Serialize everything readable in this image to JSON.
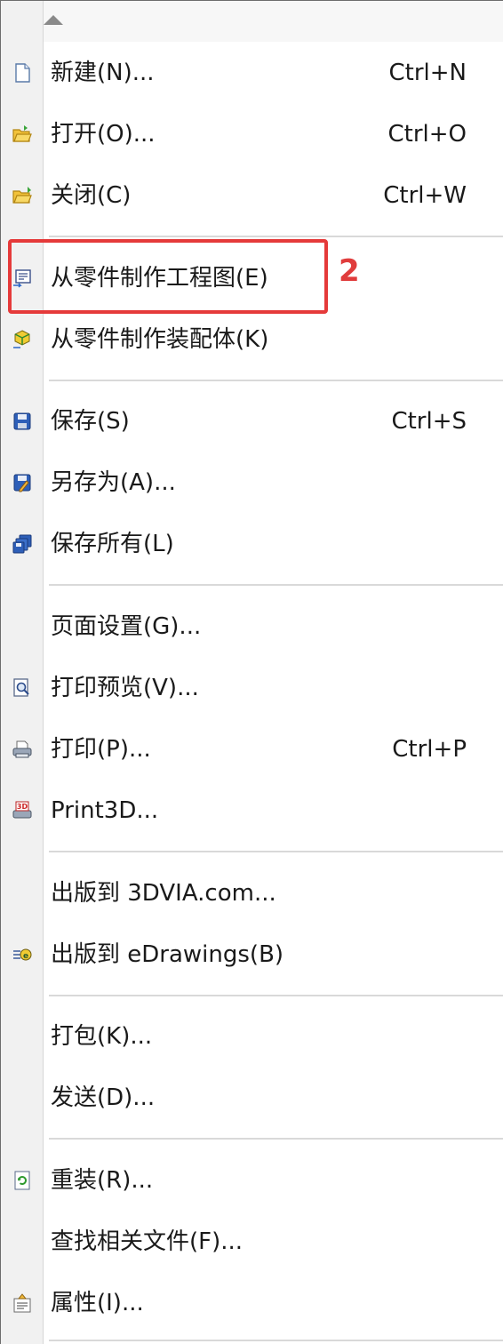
{
  "menu": {
    "scroll_up_icon": "triangle-up-icon",
    "items": [
      {
        "label": "新建(N)...",
        "shortcut": "Ctrl+N",
        "icon": "new-document-icon"
      },
      {
        "label": "打开(O)...",
        "shortcut": "Ctrl+O",
        "icon": "open-folder-icon"
      },
      {
        "label": "关闭(C)",
        "shortcut": "Ctrl+W",
        "icon": "close-folder-icon"
      },
      {
        "label": "从零件制作工程图(E)",
        "shortcut": "",
        "icon": "make-drawing-icon"
      },
      {
        "label": "从零件制作装配体(K)",
        "shortcut": "",
        "icon": "make-assembly-icon"
      },
      {
        "label": "保存(S)",
        "shortcut": "Ctrl+S",
        "icon": "save-icon"
      },
      {
        "label": "另存为(A)...",
        "shortcut": "",
        "icon": "save-as-icon"
      },
      {
        "label": "保存所有(L)",
        "shortcut": "",
        "icon": "save-all-icon"
      },
      {
        "label": "页面设置(G)...",
        "shortcut": "",
        "icon": ""
      },
      {
        "label": "打印预览(V)...",
        "shortcut": "",
        "icon": "print-preview-icon"
      },
      {
        "label": "打印(P)...",
        "shortcut": "Ctrl+P",
        "icon": "printer-icon"
      },
      {
        "label": "Print3D...",
        "shortcut": "",
        "icon": "print-3d-icon"
      },
      {
        "label": "出版到 3DVIA.com...",
        "shortcut": "",
        "icon": ""
      },
      {
        "label": "出版到 eDrawings(B)",
        "shortcut": "",
        "icon": "edrawings-icon"
      },
      {
        "label": "打包(K)...",
        "shortcut": "",
        "icon": ""
      },
      {
        "label": "发送(D)...",
        "shortcut": "",
        "icon": ""
      },
      {
        "label": "重装(R)...",
        "shortcut": "",
        "icon": "reload-icon"
      },
      {
        "label": "查找相关文件(F)...",
        "shortcut": "",
        "icon": ""
      },
      {
        "label": "属性(I)...",
        "shortcut": "",
        "icon": "properties-icon"
      }
    ]
  },
  "annotation": {
    "step_number": "2",
    "color": "#e53a3a"
  }
}
